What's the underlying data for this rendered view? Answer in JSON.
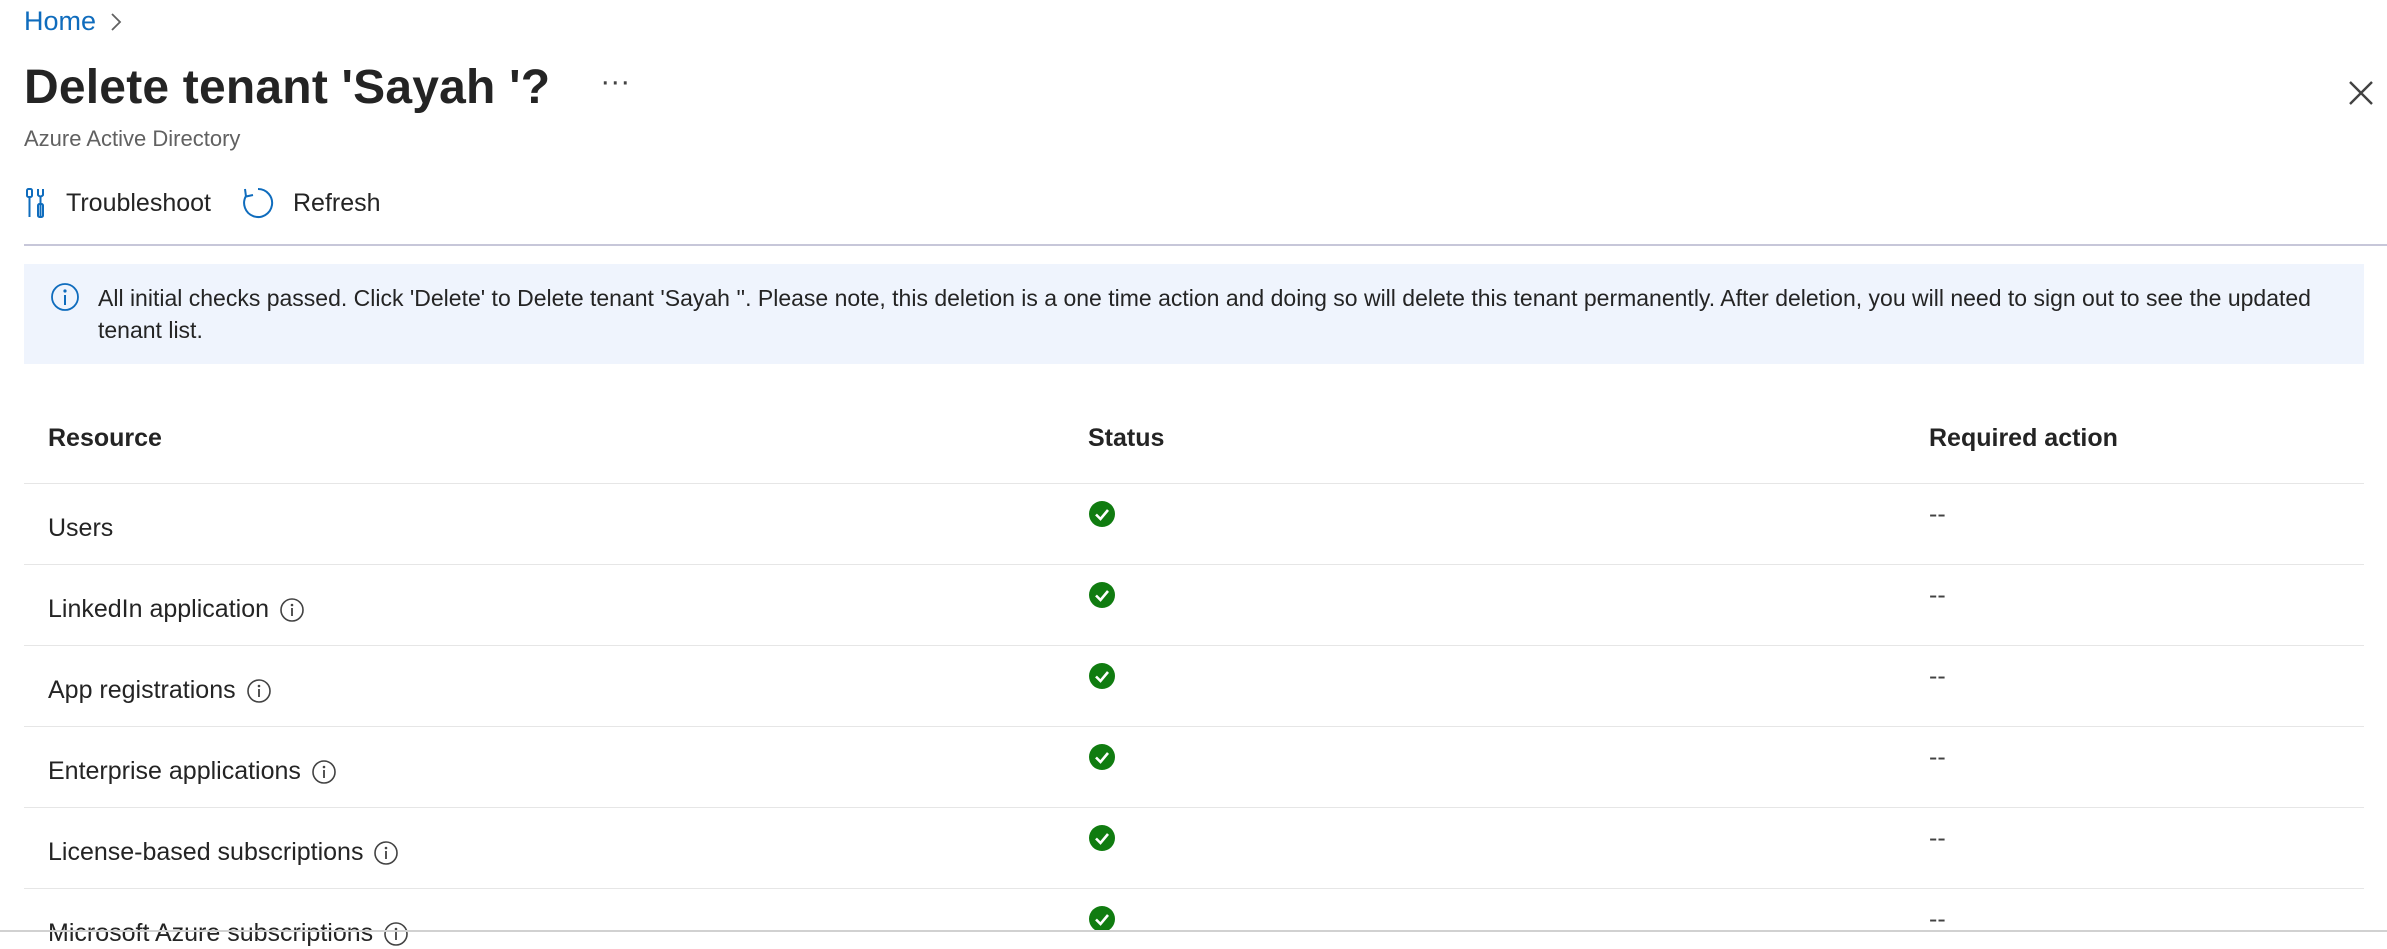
{
  "breadcrumb": {
    "home_label": "Home"
  },
  "header": {
    "title": "Delete tenant 'Sayah '?",
    "more_label": "···",
    "subtitle": "Azure Active Directory"
  },
  "toolbar": {
    "troubleshoot_label": "Troubleshoot",
    "refresh_label": "Refresh"
  },
  "info_bar": {
    "message": "All initial checks passed. Click 'Delete' to Delete tenant 'Sayah ''. Please note, this deletion is a one time action and doing so will delete this tenant permanently. After deletion, you will need to sign out to see the updated tenant list."
  },
  "table": {
    "headers": {
      "resource": "Resource",
      "status": "Status",
      "action": "Required action"
    },
    "rows": [
      {
        "resource": "Users",
        "has_info": false,
        "status": "passed",
        "action": "--"
      },
      {
        "resource": "LinkedIn application",
        "has_info": true,
        "status": "passed",
        "action": "--"
      },
      {
        "resource": "App registrations",
        "has_info": true,
        "status": "passed",
        "action": "--"
      },
      {
        "resource": "Enterprise applications",
        "has_info": true,
        "status": "passed",
        "action": "--"
      },
      {
        "resource": "License-based subscriptions",
        "has_info": true,
        "status": "passed",
        "action": "--"
      },
      {
        "resource": "Microsoft Azure subscriptions",
        "has_info": true,
        "status": "passed",
        "action": "--"
      }
    ]
  },
  "colors": {
    "link": "#0f6cbd",
    "success": "#107c10",
    "info_bg": "#eff4fd",
    "info_icon": "#0f6cbd"
  },
  "icons": {
    "breadcrumb_separator": "chevron-right-icon",
    "close": "close-icon",
    "troubleshoot": "wrench-icon",
    "refresh": "refresh-icon",
    "info": "info-icon",
    "status_passed": "checkmark-circle-icon",
    "resource_help": "info-icon"
  }
}
